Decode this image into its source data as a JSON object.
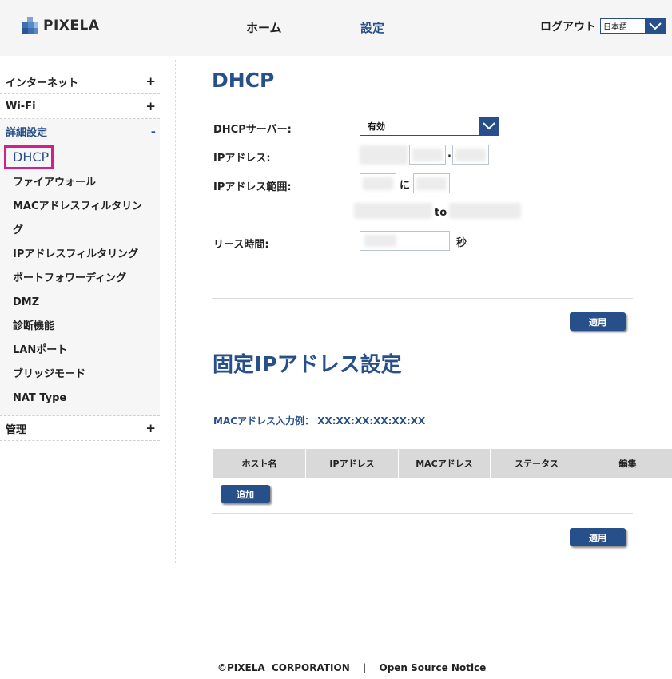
{
  "header": {
    "logo_text": "PIXELA",
    "nav_home": "ホーム",
    "nav_settings": "設定",
    "logout": "ログアウト",
    "language_value": "日本語"
  },
  "sidebar": {
    "internet": "インターネット",
    "wifi": "Wi-Fi",
    "advanced": "詳細設定",
    "advanced_items": [
      "DHCP",
      "ファイアウォール",
      "MACアドレスフィルタリン",
      "グ",
      "IPアドレスフィルタリング",
      "ポートフォワーディング",
      "DMZ",
      "診断機能",
      "LANポート",
      "ブリッジモード",
      "NAT Type"
    ],
    "admin": "管理",
    "plus": "+",
    "minus": "-"
  },
  "dhcp": {
    "title": "DHCP",
    "server_label": "DHCPサーバー:",
    "server_value": "有効",
    "ip_label": "IPアドレス:",
    "ip_dot": ".",
    "range_label": "IPアドレス範囲:",
    "range_ni": "に",
    "range_to": "to",
    "lease_label": "リース時間:",
    "lease_unit": "秒",
    "apply": "適用"
  },
  "static_ip": {
    "title": "固定IPアドレス設定",
    "mac_example": "MACアドレス入力例： XX:XX:XX:XX:XX:XX",
    "columns": [
      "ホスト名",
      "IPアドレス",
      "MACアドレス",
      "ステータス",
      "編集"
    ],
    "add": "追加",
    "apply": "適用"
  },
  "footer": {
    "copyright": "©PIXELA  CORPORATION",
    "separator": "|",
    "oss": "Open Source Notice"
  }
}
